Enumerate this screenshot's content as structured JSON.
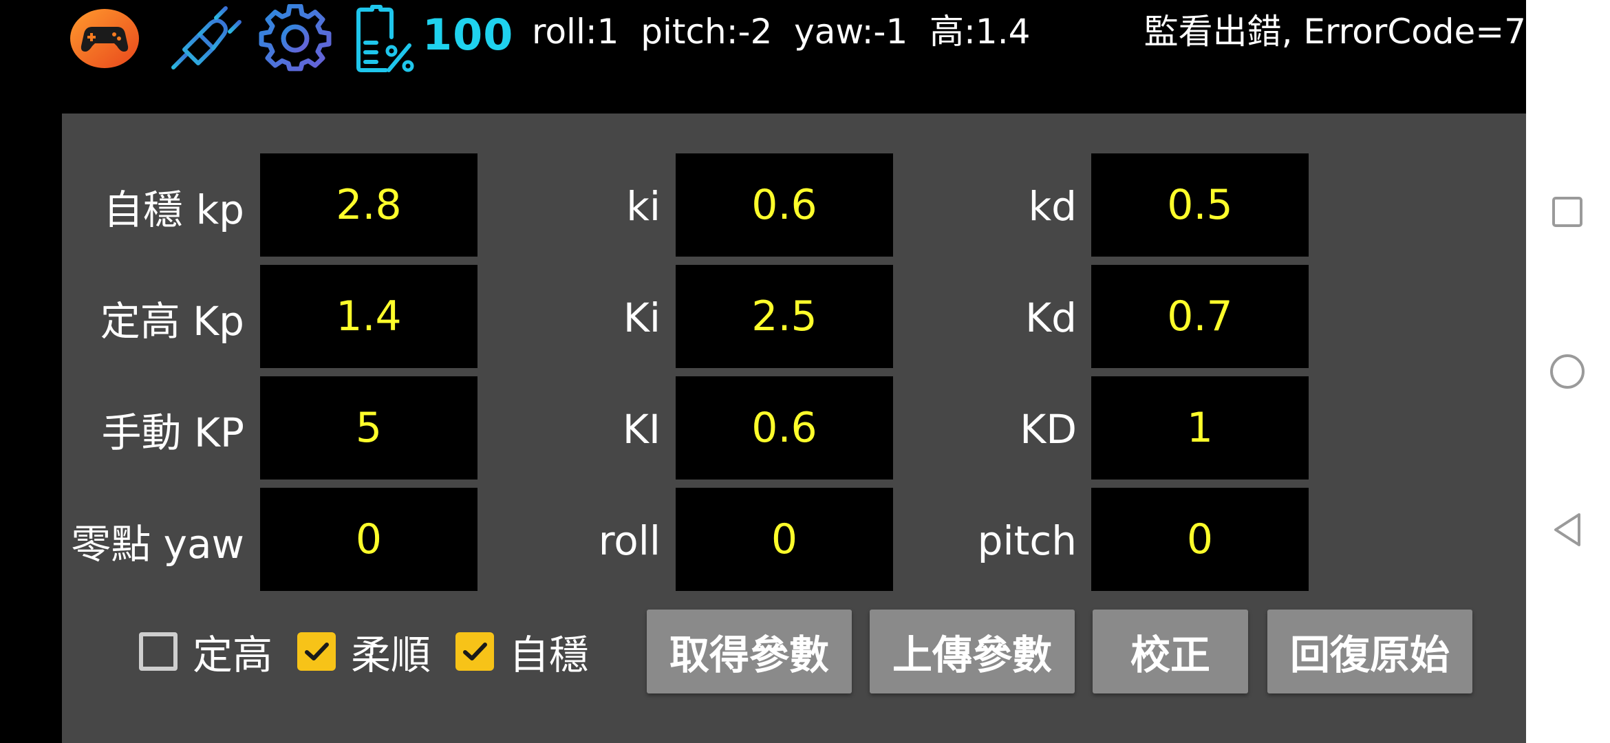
{
  "status_bar": {
    "icons": [
      "gamepad-icon",
      "plug-icon",
      "gear-icon",
      "battery-icon"
    ],
    "battery_percent": "100",
    "telemetry": "roll:1  pitch:-2  yaw:-1  高:1.4",
    "error": "監看出錯, ErrorCode=7",
    "colors": {
      "gamepad_orange": "#f47a20",
      "icon_blue": "#2f8fd8",
      "battery_cyan": "#1fd2ee"
    }
  },
  "panel": {
    "background": "#474747",
    "value_color": "#ffff2b",
    "rows": [
      {
        "label": "自穩 kp",
        "value1": "2.8",
        "label2": "ki",
        "value2": "0.6",
        "label3": "kd",
        "value3": "0.5"
      },
      {
        "label": "定高 Kp",
        "value1": "1.4",
        "label2": "Ki",
        "value2": "2.5",
        "label3": "Kd",
        "value3": "0.7"
      },
      {
        "label": "手動 KP",
        "value1": "5",
        "label2": "KI",
        "value2": "0.6",
        "label3": "KD",
        "value3": "1"
      },
      {
        "label": "零點 yaw",
        "value1": "0",
        "label2": "roll",
        "value2": "0",
        "label3": "pitch",
        "value3": "0"
      }
    ],
    "checks": [
      {
        "label": "定高",
        "checked": false
      },
      {
        "label": "柔順",
        "checked": true
      },
      {
        "label": "自穩",
        "checked": true
      }
    ],
    "buttons": {
      "get_params": "取得參數",
      "upload_params": "上傳參數",
      "calibrate": "校正",
      "restore": "回復原始"
    }
  },
  "navigation": {
    "icons": [
      "recents-square-icon",
      "home-circle-icon",
      "back-triangle-icon"
    ]
  }
}
